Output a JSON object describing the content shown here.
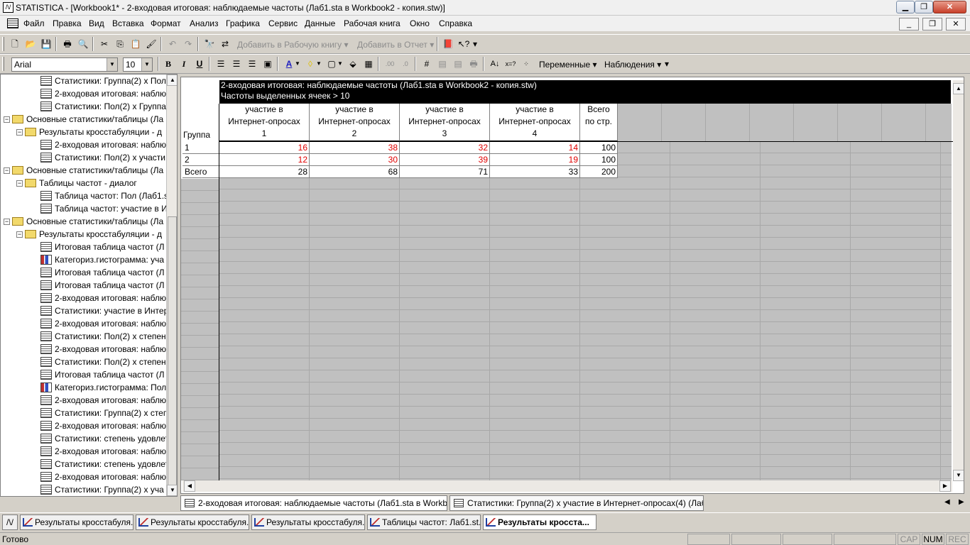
{
  "window": {
    "app_icon": "statistica-app-icon",
    "title": "STATISTICA - [Workbook1* - 2-входовая итоговая: наблюдаемые частоты (Лаб1.sta в Workbook2 - копия.stw)]",
    "min_label": "▁",
    "max_label": "❐",
    "close_label": "✕"
  },
  "menu": {
    "items": [
      "Файл",
      "Правка",
      "Вид",
      "Вставка",
      "Формат",
      "Анализ",
      "Графика",
      "Сервис",
      "Данные",
      "Рабочая книга",
      "Окно",
      "Справка"
    ],
    "doc_min": "_",
    "doc_restore": "❐",
    "doc_close": "✕"
  },
  "toolbar1": {
    "add_workbook": "Добавить в Рабочую книгу",
    "add_report": "Добавить в Отчет",
    "dropdown_arrow": "▾"
  },
  "toolbar2": {
    "font_name": "Arial",
    "font_size": "10",
    "bold": "B",
    "italic": "I",
    "underline": "U",
    "variables": "Переменные",
    "observations": "Наблюдения"
  },
  "tree": {
    "items": [
      {
        "label": "Статистики: Группа(2) x Пол",
        "type": "sheet"
      },
      {
        "label": "2-входовая итоговая: наблю",
        "type": "sheet"
      },
      {
        "label": "Статистики: Пол(2) x Группа",
        "type": "sheet"
      },
      {
        "label": "Основные статистики/таблицы (Ла",
        "type": "folder"
      },
      {
        "label": "Результаты кросстабуляции - д",
        "type": "folder"
      },
      {
        "label": "2-входовая итоговая: наблю",
        "type": "sheet"
      },
      {
        "label": "Статистики: Пол(2) x участи",
        "type": "sheet"
      },
      {
        "label": "Основные статистики/таблицы (Ла",
        "type": "folder"
      },
      {
        "label": "Таблицы частот - диалог",
        "type": "folder"
      },
      {
        "label": "Таблица частот: Пол (Лаб1.s",
        "type": "sheet"
      },
      {
        "label": "Таблица частот: участие в И",
        "type": "sheet"
      },
      {
        "label": "Основные статистики/таблицы (Ла",
        "type": "folder"
      },
      {
        "label": "Результаты кросстабуляции - д",
        "type": "folder"
      },
      {
        "label": "Итоговая таблица частот (Л",
        "type": "sheet"
      },
      {
        "label": "Категориз.гистограмма: уча",
        "type": "graph"
      },
      {
        "label": "Итоговая таблица частот (Л",
        "type": "sheet"
      },
      {
        "label": "Итоговая таблица частот (Л",
        "type": "sheet"
      },
      {
        "label": "2-входовая итоговая: наблю",
        "type": "sheet"
      },
      {
        "label": "Статистики: участие в Интер",
        "type": "sheet"
      },
      {
        "label": "2-входовая итоговая: наблю",
        "type": "sheet"
      },
      {
        "label": "Статистики: Пол(2) x степен",
        "type": "sheet"
      },
      {
        "label": "2-входовая итоговая: наблю",
        "type": "sheet"
      },
      {
        "label": "Статистики: Пол(2) x степен",
        "type": "sheet"
      },
      {
        "label": "Итоговая таблица частот (Л",
        "type": "sheet"
      },
      {
        "label": "Категориз.гистограмма: Пол",
        "type": "graph"
      },
      {
        "label": "2-входовая итоговая: наблю",
        "type": "sheet"
      },
      {
        "label": "Статистики: Группа(2) x степ",
        "type": "sheet"
      },
      {
        "label": "2-входовая итоговая: наблю",
        "type": "sheet"
      },
      {
        "label": "Статистики: степень удовлет",
        "type": "sheet"
      },
      {
        "label": "2-входовая итоговая: наблю",
        "type": "sheet"
      },
      {
        "label": "Статистики: степень удовлет",
        "type": "sheet"
      },
      {
        "label": "2-входовая итоговая: наблю",
        "type": "sheet"
      },
      {
        "label": "Статистики: Группа(2) x уча",
        "type": "sheet"
      }
    ]
  },
  "sheet": {
    "header_line1": "2-входовая итоговая: наблюдаемые частоты (Лаб1.sta в Workbook2 - копия.stw)",
    "header_line2": "Частоты выделенных ячеек > 10",
    "corner_label": "Группа",
    "columns": [
      {
        "l1": "участие в",
        "l2": "Интернет-опросах",
        "l3": "1"
      },
      {
        "l1": "участие в",
        "l2": "Интернет-опросах",
        "l3": "2"
      },
      {
        "l1": "участие в",
        "l2": "Интернет-опросах",
        "l3": "3"
      },
      {
        "l1": "участие в",
        "l2": "Интернет-опросах",
        "l3": "4"
      },
      {
        "l1": "Всего",
        "l2": "по стр.",
        "l3": ""
      }
    ],
    "rows": [
      {
        "label": "1",
        "values": [
          "16",
          "38",
          "32",
          "14",
          "100"
        ]
      },
      {
        "label": "2",
        "values": [
          "12",
          "30",
          "39",
          "19",
          "100"
        ]
      },
      {
        "label": "Всего",
        "values": [
          "28",
          "68",
          "71",
          "33",
          "200"
        ]
      }
    ],
    "highlight_color": "#e00000"
  },
  "doc_tabs": [
    "2-входовая итоговая: наблюдаемые частоты (Лаб1.sta в Workbook...",
    "Статистики: Группа(2) x участие в Интернет-опросах(4) (Лаб1.s..."
  ],
  "tasks": [
    "Результаты кросстабуля...",
    "Результаты кросстабуля...",
    "Результаты кросстабуля...",
    "Таблицы частот: Лаб1.st...",
    "Результаты кросста..."
  ],
  "status": {
    "text": "Готово",
    "cap": "CAP",
    "num": "NUM",
    "rec": "REC"
  }
}
